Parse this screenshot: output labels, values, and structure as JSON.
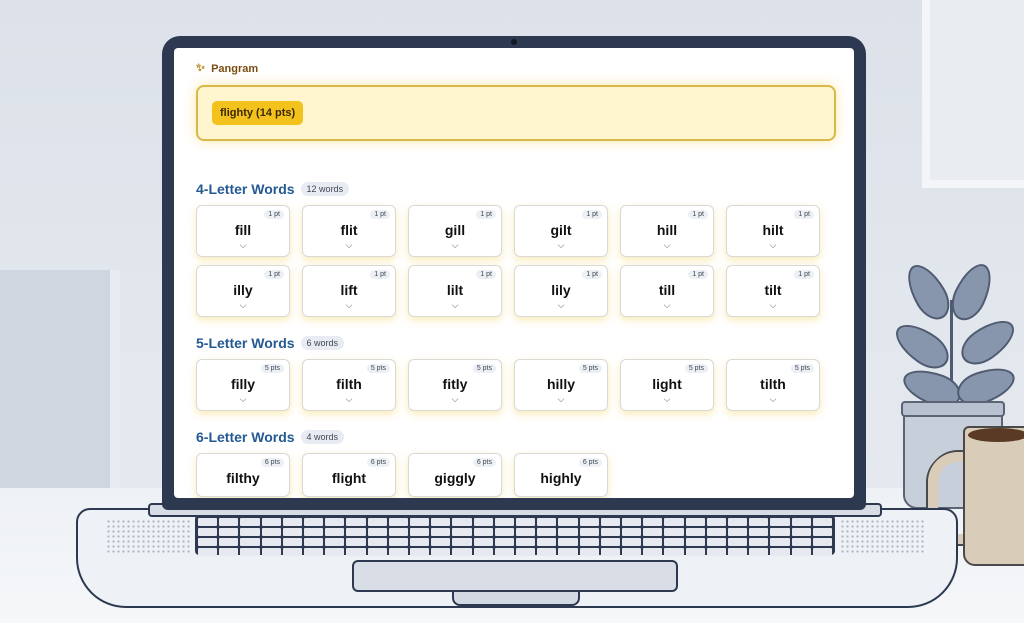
{
  "pangram": {
    "heading": "Pangram",
    "chip": "flighty (14 pts)"
  },
  "sections": [
    {
      "title": "4-Letter Words",
      "count": "12 words",
      "words": [
        {
          "word": "fill",
          "pts": "1 pt"
        },
        {
          "word": "flit",
          "pts": "1 pt"
        },
        {
          "word": "gill",
          "pts": "1 pt"
        },
        {
          "word": "gilt",
          "pts": "1 pt"
        },
        {
          "word": "hill",
          "pts": "1 pt"
        },
        {
          "word": "hilt",
          "pts": "1 pt"
        },
        {
          "word": "illy",
          "pts": "1 pt"
        },
        {
          "word": "lift",
          "pts": "1 pt"
        },
        {
          "word": "lilt",
          "pts": "1 pt"
        },
        {
          "word": "lily",
          "pts": "1 pt"
        },
        {
          "word": "till",
          "pts": "1 pt"
        },
        {
          "word": "tilt",
          "pts": "1 pt"
        }
      ]
    },
    {
      "title": "5-Letter Words",
      "count": "6 words",
      "words": [
        {
          "word": "filly",
          "pts": "5 pts"
        },
        {
          "word": "filth",
          "pts": "5 pts"
        },
        {
          "word": "fitly",
          "pts": "5 pts"
        },
        {
          "word": "hilly",
          "pts": "5 pts"
        },
        {
          "word": "light",
          "pts": "5 pts"
        },
        {
          "word": "tilth",
          "pts": "5 pts"
        }
      ]
    },
    {
      "title": "6-Letter Words",
      "count": "4 words",
      "words": [
        {
          "word": "filthy",
          "pts": "6 pts"
        },
        {
          "word": "flight",
          "pts": "6 pts"
        },
        {
          "word": "giggly",
          "pts": "6 pts"
        },
        {
          "word": "highly",
          "pts": "6 pts"
        }
      ]
    }
  ],
  "icons": {
    "sparkle": "sparkle-icon",
    "expand": "chevron-down-icon"
  },
  "colors": {
    "accent": "#f3c21c",
    "section_title": "#245a92",
    "pangram_border": "#d9b84a"
  }
}
